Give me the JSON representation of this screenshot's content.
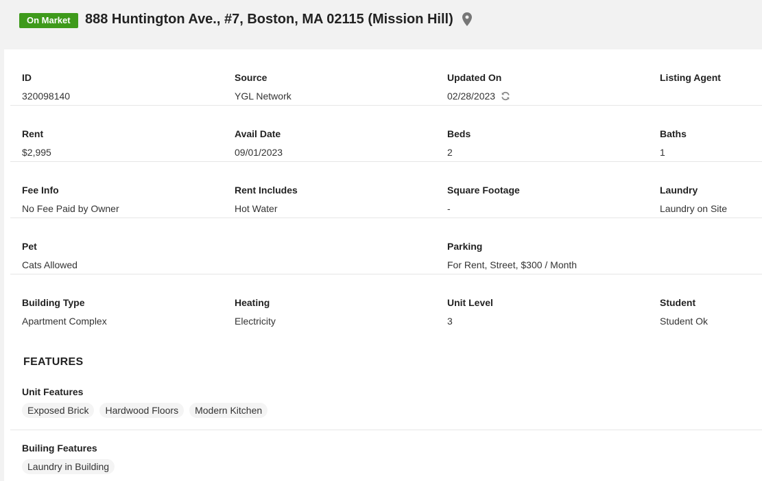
{
  "header": {
    "status_badge": "On Market",
    "address": "888 Huntington Ave., #7, Boston, MA 02115 (Mission Hill)",
    "location_icon": "map-pin-icon"
  },
  "details": {
    "rows": [
      [
        {
          "label": "ID",
          "value": "320098140"
        },
        {
          "label": "Source",
          "value": "YGL Network"
        },
        {
          "label": "Updated On",
          "value": "02/28/2023"
        },
        {
          "label": "Listing Agent",
          "value": ""
        }
      ],
      [
        {
          "label": "Rent",
          "value": "$2,995"
        },
        {
          "label": "Avail Date",
          "value": "09/01/2023"
        },
        {
          "label": "Beds",
          "value": "2"
        },
        {
          "label": "Baths",
          "value": "1"
        }
      ],
      [
        {
          "label": "Fee Info",
          "value": "No Fee Paid by Owner"
        },
        {
          "label": "Rent Includes",
          "value": "Hot Water"
        },
        {
          "label": "Square Footage",
          "value": "-"
        },
        {
          "label": "Laundry",
          "value": "Laundry on Site"
        }
      ],
      [
        {
          "label": "Pet",
          "value": "Cats Allowed"
        },
        {
          "label": "",
          "value": ""
        },
        {
          "label": "Parking",
          "value": "For Rent, Street, $300 / Month"
        },
        {
          "label": "",
          "value": ""
        }
      ],
      [
        {
          "label": "Building Type",
          "value": "Apartment Complex"
        },
        {
          "label": "Heating",
          "value": "Electricity"
        },
        {
          "label": "Unit Level",
          "value": "3"
        },
        {
          "label": "Student",
          "value": "Student Ok"
        }
      ]
    ]
  },
  "features": {
    "title": "FEATURES",
    "unit": {
      "label": "Unit Features",
      "tags": [
        "Exposed Brick",
        "Hardwood Floors",
        "Modern Kitchen"
      ]
    },
    "building": {
      "label": "Builing Features",
      "tags": [
        "Laundry in Building"
      ]
    }
  },
  "colors": {
    "badge_bg": "#3e9a1b",
    "page_bg": "#f2f2f2",
    "panel_bg": "#ffffff"
  }
}
